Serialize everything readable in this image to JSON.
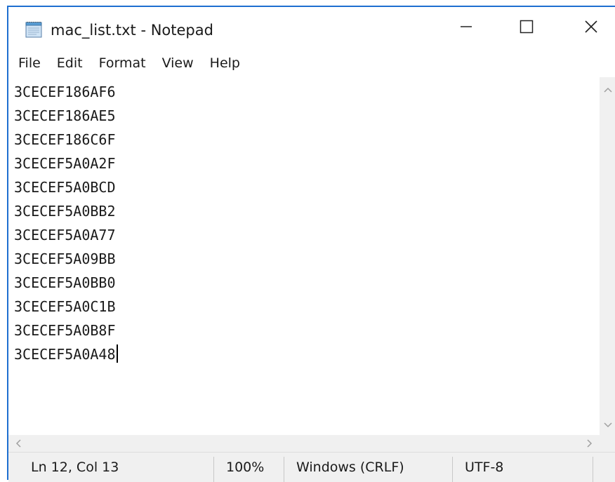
{
  "window": {
    "title": "mac_list.txt - Notepad",
    "icon": "notepad-icon",
    "accent_color": "#1e6fd0"
  },
  "window_controls": {
    "minimize_icon": "minimize-icon",
    "maximize_icon": "maximize-icon",
    "close_icon": "close-icon"
  },
  "menu": {
    "items": [
      "File",
      "Edit",
      "Format",
      "View",
      "Help"
    ]
  },
  "editor": {
    "lines": [
      "3CECEF186AF6",
      "3CECEF186AE5",
      "3CECEF186C6F",
      "3CECEF5A0A2F",
      "3CECEF5A0BCD",
      "3CECEF5A0BB2",
      "3CECEF5A0A77",
      "3CECEF5A09BB",
      "3CECEF5A0BB0",
      "3CECEF5A0C1B",
      "3CECEF5A0B8F",
      "3CECEF5A0A48"
    ]
  },
  "statusbar": {
    "position": "Ln 12, Col 13",
    "zoom": "100%",
    "line_ending": "Windows (CRLF)",
    "encoding": "UTF-8"
  }
}
